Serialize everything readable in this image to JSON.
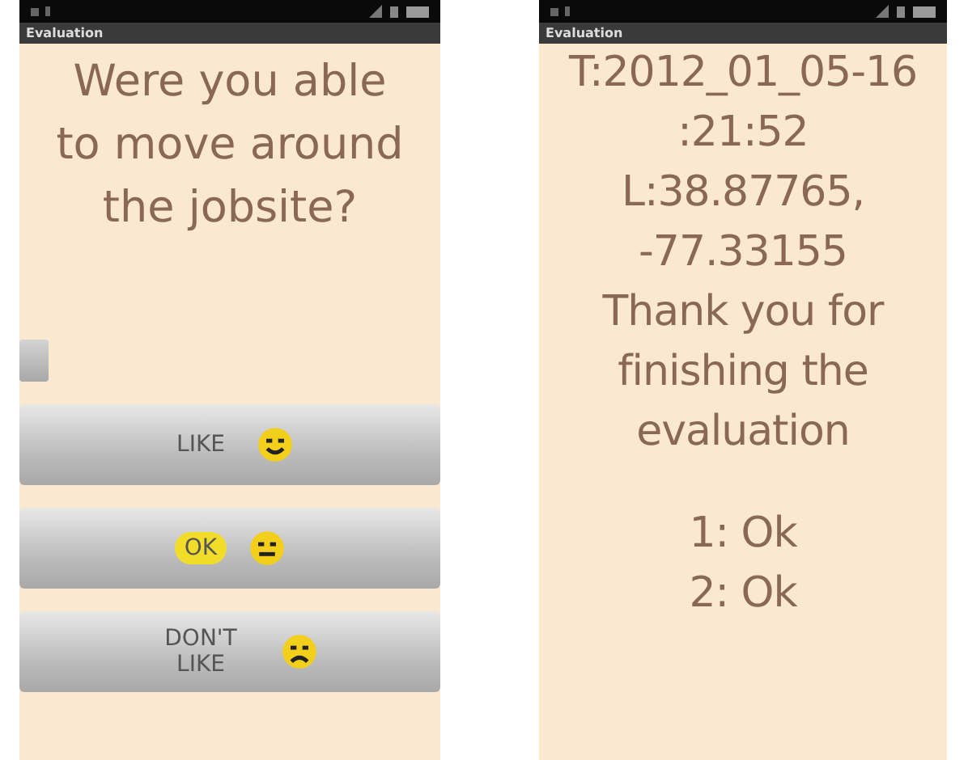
{
  "question_screen": {
    "title": "Evaluation",
    "question": "Were you able to move around the jobsite?",
    "answers": [
      {
        "label": "LIKE",
        "kind": "happy",
        "selected": false
      },
      {
        "label": "OK",
        "kind": "neutral",
        "selected": true
      },
      {
        "label": "DON'T LIKE",
        "kind": "sad",
        "selected": false
      }
    ]
  },
  "result_screen": {
    "title": "Evaluation",
    "lines": [
      "T:2012_01_05-16",
      ":21:52",
      "L:38.87765,",
      "-77.33155",
      "Thank you for finishing the evaluation"
    ],
    "results": [
      "1: Ok",
      "2: Ok"
    ]
  }
}
